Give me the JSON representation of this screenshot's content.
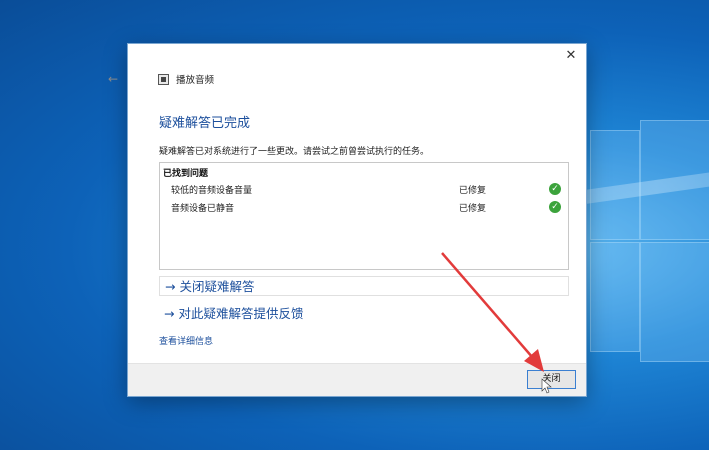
{
  "dialog": {
    "app_title": "播放音频",
    "main_title": "疑难解答已完成",
    "description": "疑难解答已对系统进行了一些更改。请尝试之前曾尝试执行的任务。",
    "results_header": "已找到问题",
    "results": [
      {
        "name": "较低的音频设备音量",
        "status": "已修复"
      },
      {
        "name": "音频设备已静音",
        "status": "已修复"
      }
    ],
    "link_close": "→ 关闭疑难解答",
    "link_feedback": "→ 对此疑难解答提供反馈",
    "details_link": "查看详细信息",
    "close_button": "关闭"
  },
  "colors": {
    "link_blue": "#1c4f9c",
    "success_green": "#3ca33c",
    "annotation_red": "#e23b3b"
  },
  "icons": [
    "back-arrow-icon",
    "app-icon",
    "close-icon",
    "check-icon",
    "red-arrow-annotation"
  ]
}
